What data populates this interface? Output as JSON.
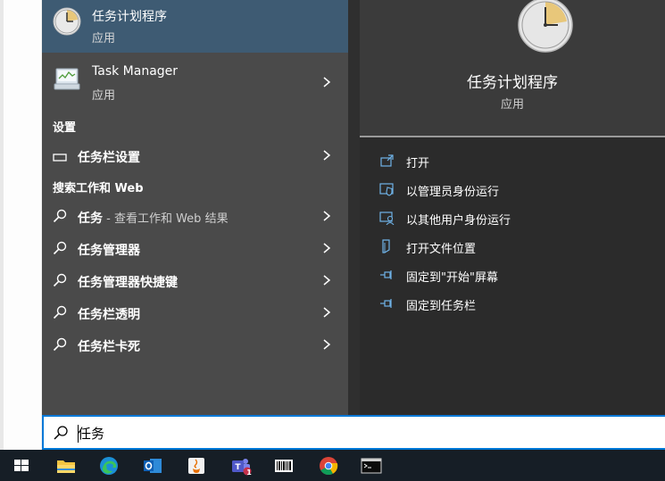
{
  "best_match": {
    "title": "任务计划程序",
    "subtitle": "应用"
  },
  "results": [
    {
      "title": "Task Manager",
      "subtitle": "应用"
    }
  ],
  "settings": {
    "header": "设置",
    "items": [
      {
        "label": "任务栏设置"
      }
    ]
  },
  "web": {
    "header": "搜索工作和 Web",
    "items": [
      {
        "label": "任务",
        "suffix": " - 查看工作和 Web 结果"
      },
      {
        "label": "任务管理器"
      },
      {
        "label": "任务管理器快捷键"
      },
      {
        "label": "任务栏透明"
      },
      {
        "label": "任务栏卡死"
      }
    ]
  },
  "details": {
    "title": "任务计划程序",
    "subtitle": "应用",
    "actions": [
      {
        "label": "打开",
        "icon": "open-icon"
      },
      {
        "label": "以管理员身份运行",
        "icon": "shield-icon"
      },
      {
        "label": "以其他用户身份运行",
        "icon": "user-icon"
      },
      {
        "label": "打开文件位置",
        "icon": "file-location-icon"
      },
      {
        "label": "固定到\"开始\"屏幕",
        "icon": "pin-icon"
      },
      {
        "label": "固定到任务栏",
        "icon": "pin-icon"
      }
    ]
  },
  "search": {
    "value": "任务"
  },
  "taskbar": {
    "items": [
      "start-icon",
      "file-explorer-icon",
      "edge-icon",
      "outlook-icon",
      "java-icon",
      "teams-icon",
      "barcode-app-icon",
      "chrome-icon",
      "terminal-icon"
    ],
    "teams_badge": "1"
  },
  "colors": {
    "accent": "#0078d7",
    "selected": "#3e5b73",
    "panel": "#4a4a4a",
    "details": "#2b2b2b"
  }
}
